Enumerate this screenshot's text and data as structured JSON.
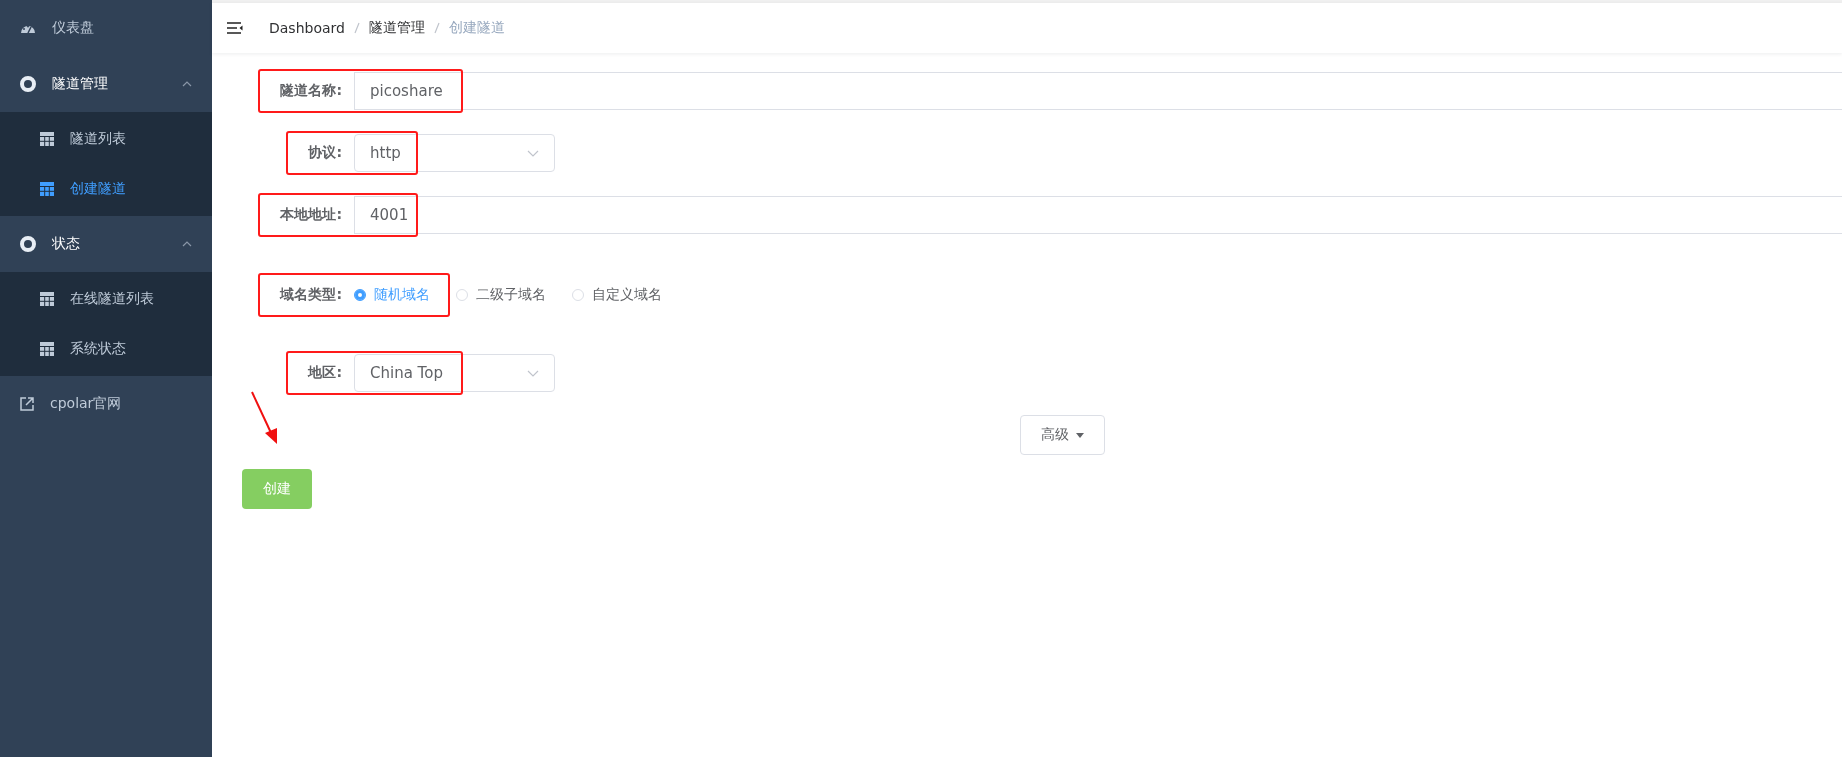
{
  "sidebar": {
    "items": [
      {
        "kind": "dashboard",
        "label": "仪表盘"
      },
      {
        "kind": "group",
        "label": "隧道管理",
        "expanded": true,
        "children": [
          {
            "label": "隧道列表",
            "selected": false
          },
          {
            "label": "创建隧道",
            "selected": true
          }
        ]
      },
      {
        "kind": "group",
        "label": "状态",
        "expanded": true,
        "children": [
          {
            "label": "在线隧道列表",
            "selected": false
          },
          {
            "label": "系统状态",
            "selected": false
          }
        ]
      },
      {
        "kind": "external",
        "label": "cpolar官网"
      }
    ]
  },
  "breadcrumb": [
    "Dashboard",
    "隧道管理",
    "创建隧道"
  ],
  "form": {
    "fields": [
      {
        "kind": "text",
        "label": "隧道名称:",
        "value": "picoshare",
        "highlighted": true
      },
      {
        "kind": "select",
        "label": "协议:",
        "value": "http",
        "highlighted": true
      },
      {
        "kind": "text",
        "label": "本地地址:",
        "value": "4001",
        "highlighted": true
      },
      {
        "kind": "radio",
        "label": "域名类型:",
        "highlighted": true,
        "options": [
          {
            "label": "随机域名",
            "selected": true
          },
          {
            "label": "二级子域名",
            "selected": false
          },
          {
            "label": "自定义域名",
            "selected": false
          }
        ]
      },
      {
        "kind": "select",
        "label": "地区:",
        "value": "China Top",
        "highlighted": true
      }
    ],
    "advanced_button": "高级",
    "submit_button": "创建"
  }
}
